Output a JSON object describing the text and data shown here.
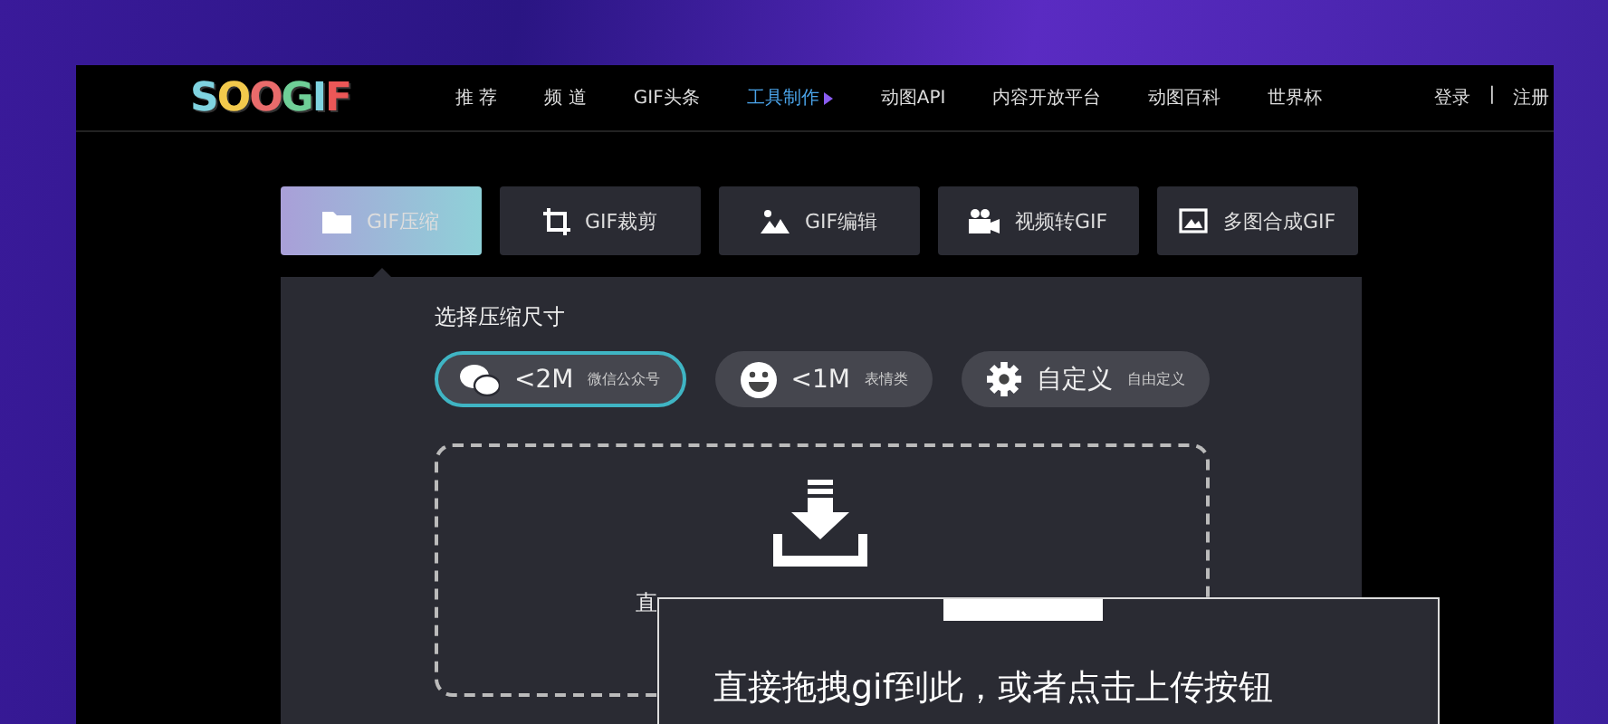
{
  "logo": "SOOGIF",
  "nav": [
    {
      "label": "推 荐",
      "selected": false
    },
    {
      "label": "频 道",
      "selected": false
    },
    {
      "label": "GIF头条",
      "selected": false
    },
    {
      "label": "工具制作",
      "selected": true
    },
    {
      "label": "动图API",
      "selected": false
    },
    {
      "label": "内容开放平台",
      "selected": false
    },
    {
      "label": "动图百科",
      "selected": false
    },
    {
      "label": "世界杯",
      "selected": false
    }
  ],
  "auth": {
    "login": "登录",
    "separator": "|",
    "register": "注册"
  },
  "tools": [
    {
      "kind": "zip",
      "label": "GIF压缩",
      "selected": true
    },
    {
      "kind": "crop",
      "label": "GIF裁剪",
      "selected": false
    },
    {
      "kind": "image",
      "label": "GIF编辑",
      "selected": false
    },
    {
      "kind": "video",
      "label": "视频转GIF",
      "selected": false
    },
    {
      "kind": "gallery",
      "label": "多图合成GIF",
      "selected": false
    }
  ],
  "size_title": "选择压缩尺寸",
  "sizes": [
    {
      "kind": "chat",
      "label": "<2M",
      "note": "微信公众号",
      "selected": true
    },
    {
      "kind": "smile",
      "label": "<1M",
      "note": "表情类",
      "selected": false
    },
    {
      "kind": "gear",
      "label": "自定义",
      "note": "自由定义",
      "selected": false
    }
  ],
  "dropzone": {
    "hint": "直"
  },
  "callout": {
    "text": "直接拖拽gif到此，或者点击上传按钮"
  }
}
